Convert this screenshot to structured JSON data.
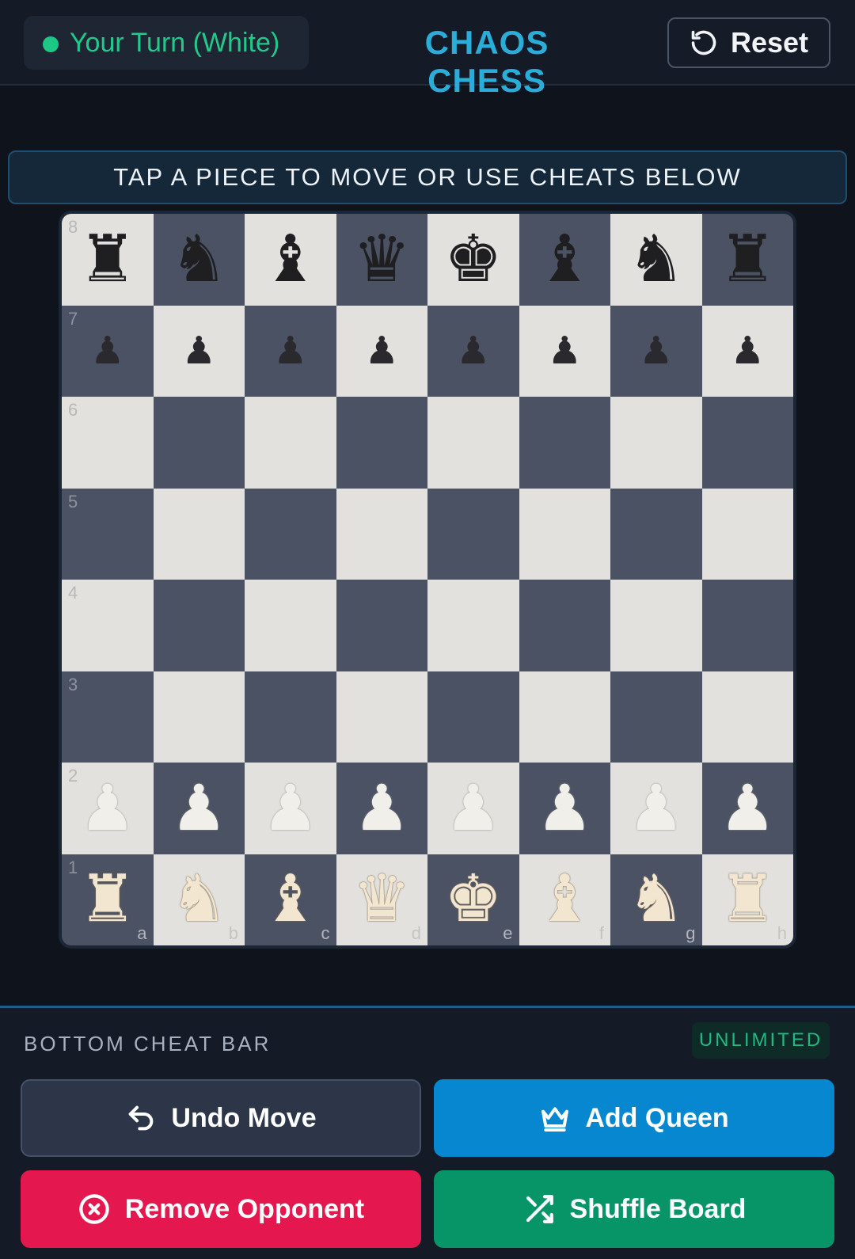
{
  "header": {
    "turn_status": "Your Turn (White)",
    "title": "CHAOS CHESS",
    "reset_label": "Reset",
    "turn_dot_color": "#1dc784",
    "title_color": "#2aaed9"
  },
  "hint": "TAP A PIECE TO MOVE OR USE CHEATS BELOW",
  "board": {
    "rank_labels": [
      "8",
      "7",
      "6",
      "5",
      "4",
      "3",
      "2",
      "1"
    ],
    "file_labels": [
      "a",
      "b",
      "c",
      "d",
      "e",
      "f",
      "g",
      "h"
    ],
    "rows": [
      [
        "bR",
        "bN",
        "bB",
        "bQ",
        "bK",
        "bB",
        "bN",
        "bR"
      ],
      [
        "bP",
        "bP",
        "bP",
        "bP",
        "bP",
        "bP",
        "bP",
        "bP"
      ],
      [
        "",
        "",
        "",
        "",
        "",
        "",
        "",
        ""
      ],
      [
        "",
        "",
        "",
        "",
        "",
        "",
        "",
        ""
      ],
      [
        "",
        "",
        "",
        "",
        "",
        "",
        "",
        ""
      ],
      [
        "",
        "",
        "",
        "",
        "",
        "",
        "",
        ""
      ],
      [
        "wP",
        "wP",
        "wP",
        "wP",
        "wP",
        "wP",
        "wP",
        "wP"
      ],
      [
        "wR",
        "wN",
        "wB",
        "wQ",
        "wK",
        "wB",
        "wN",
        "wR"
      ]
    ],
    "light_color": "#e2e1dd",
    "dark_color": "#4b5263"
  },
  "cheat_bar": {
    "title": "BOTTOM CHEAT BAR",
    "badge": "UNLIMITED",
    "undo_label": "Undo Move",
    "add_queen_label": "Add Queen",
    "remove_label": "Remove Opponent",
    "shuffle_label": "Shuffle Board",
    "undo_icon": "undo-icon",
    "add_queen_icon": "crown-icon",
    "remove_icon": "close-circle-icon",
    "shuffle_icon": "shuffle-icon"
  }
}
